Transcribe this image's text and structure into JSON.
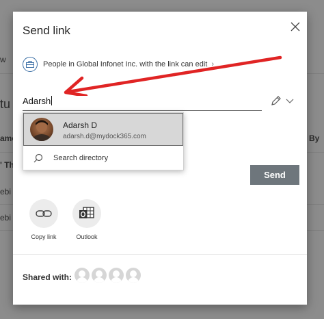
{
  "background": {
    "fragments": [
      "w",
      "tu",
      "ame",
      "' Th",
      "ebi",
      "ebi",
      "By"
    ]
  },
  "dialog": {
    "title": "Send link",
    "permission": {
      "text": "People in Global Infonet Inc. with the link can edit",
      "icon": "briefcase-icon"
    },
    "to_field": {
      "value": "Adarsh"
    },
    "suggestions": {
      "person": {
        "name": "Adarsh D",
        "email": "adarsh.d@mydock365.com"
      },
      "search_directory_label": "Search directory"
    },
    "send_label": "Send",
    "share_options": [
      {
        "label": "Copy link",
        "icon": "link-icon"
      },
      {
        "label": "Outlook",
        "icon": "outlook-icon"
      }
    ],
    "shared_with": {
      "label": "Shared with:",
      "count": 4
    }
  },
  "colors": {
    "annotation_arrow": "#e02424",
    "send_button": "#6e767c",
    "suggestion_highlight": "#d7d7d7",
    "overlay": "#8c8c8c"
  }
}
